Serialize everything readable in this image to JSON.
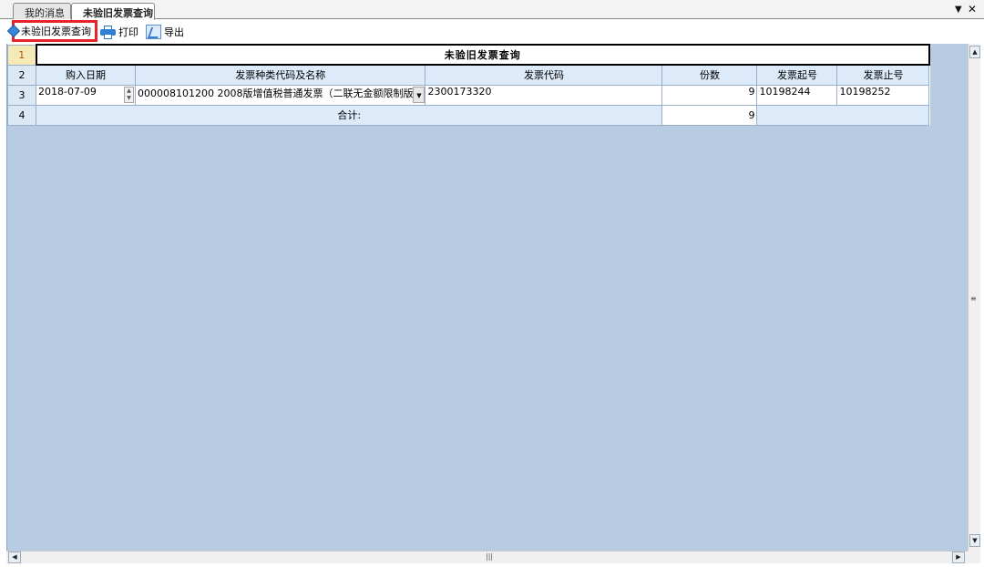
{
  "tabs": [
    {
      "label": "我的消息"
    },
    {
      "label": "未验旧发票查询"
    }
  ],
  "toolbar": {
    "query_label": "未验旧发票查询",
    "print_label": "打印",
    "export_label": "导出"
  },
  "sheet": {
    "row_numbers": [
      "1",
      "2",
      "3",
      "4"
    ],
    "title": "未验旧发票查询",
    "columns": [
      "购入日期",
      "发票种类代码及名称",
      "发票代码",
      "份数",
      "发票起号",
      "发票止号"
    ],
    "rows": [
      {
        "date": "2018-07-09",
        "type": "000008101200 2008版增值税普通发票（二联无金额限制版）",
        "code": "2300173320",
        "count": "9",
        "start": "10198244",
        "end": "10198252"
      }
    ],
    "total_label": "合计:",
    "total_value": "9"
  }
}
